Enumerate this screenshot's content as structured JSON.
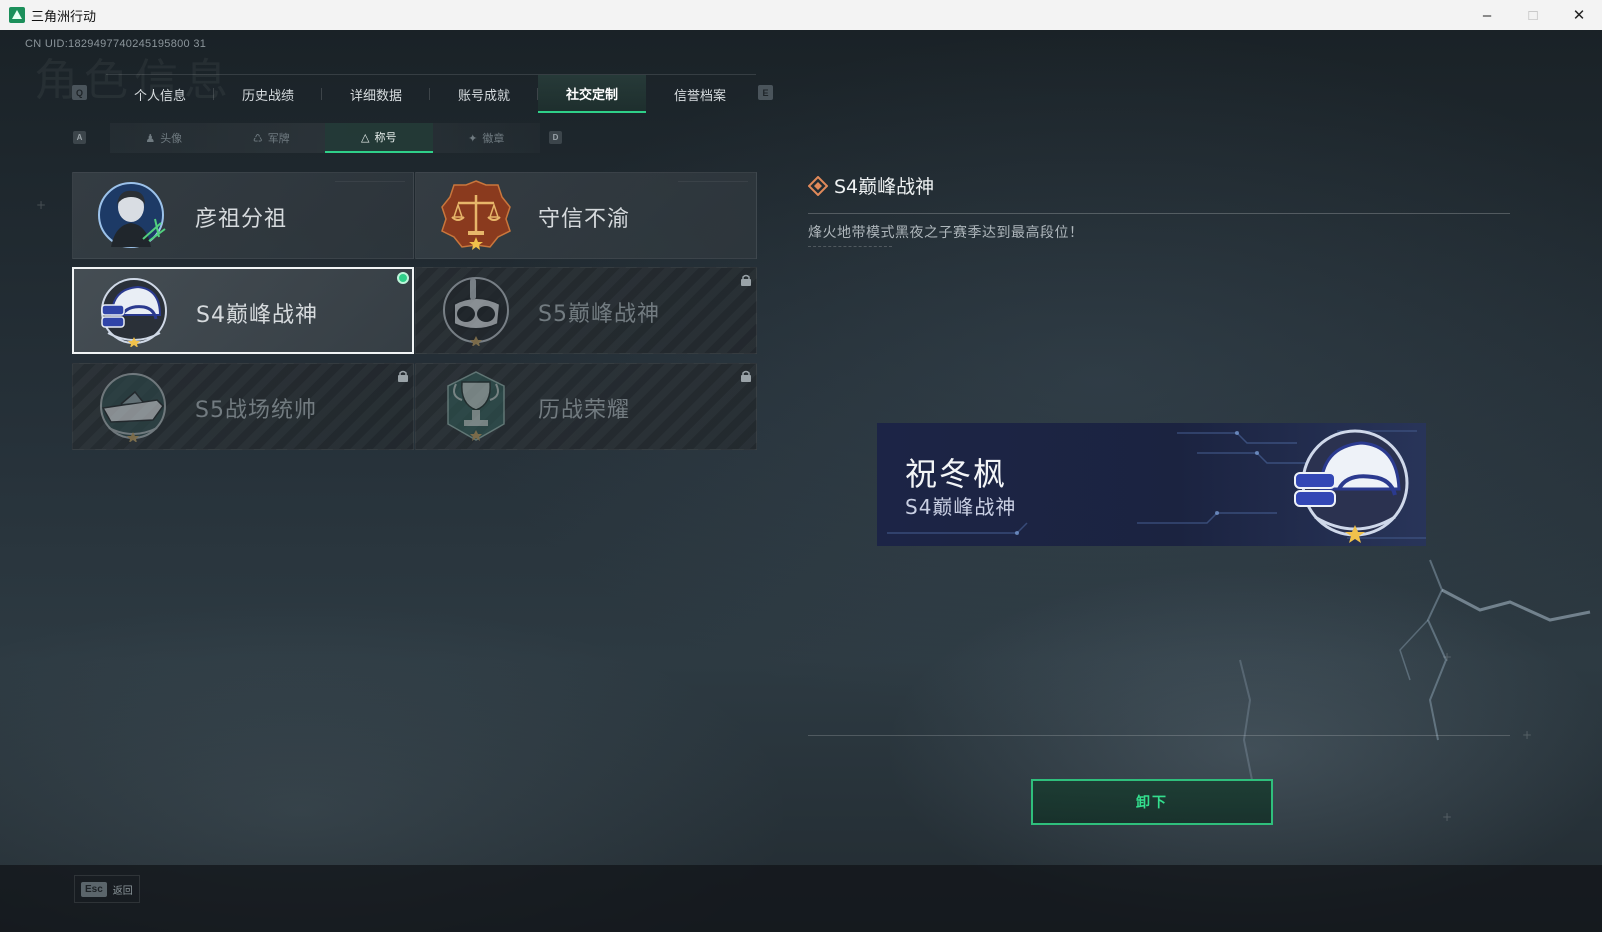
{
  "window": {
    "title": "三角洲行动",
    "minimize": "–",
    "maximize": "□",
    "close": "✕"
  },
  "uid": "CN UID:1829497740245195800 31",
  "background_title": "角色信息",
  "main_tabs": {
    "prev_key": "Q",
    "next_key": "E",
    "items": [
      {
        "label": "个人信息"
      },
      {
        "label": "历史战绩"
      },
      {
        "label": "详细数据"
      },
      {
        "label": "账号成就"
      },
      {
        "label": "社交定制",
        "active": true
      },
      {
        "label": "信誉档案"
      }
    ]
  },
  "sub_tabs": {
    "prev_key": "A",
    "next_key": "D",
    "items": [
      {
        "label": "头像",
        "icon": "person-icon"
      },
      {
        "label": "军牌",
        "icon": "dogtag-icon"
      },
      {
        "label": "称号",
        "icon": "triangle-icon",
        "active": true
      },
      {
        "label": "徽章",
        "icon": "emblem-icon"
      }
    ]
  },
  "titles": [
    {
      "name": "彦祖分祖",
      "badge": "portrait-badge-icon",
      "locked": false,
      "selected": false
    },
    {
      "name": "守信不渝",
      "badge": "scales-badge-icon",
      "locked": false,
      "selected": false
    },
    {
      "name": "S4巅峰战神",
      "badge": "night-vision-helmet-badge-icon",
      "locked": false,
      "selected": true,
      "equipped": true
    },
    {
      "name": "S5巅峰战神",
      "badge": "diving-mask-badge-icon",
      "locked": true,
      "selected": false
    },
    {
      "name": "S5战场统帅",
      "badge": "speedboat-badge-icon",
      "locked": true,
      "selected": false
    },
    {
      "name": "历战荣耀",
      "badge": "trophy-badge-icon",
      "locked": true,
      "selected": false
    }
  ],
  "detail": {
    "title": "S4巅峰战神",
    "description": "烽火地带模式黑夜之子赛季达到最高段位！",
    "nameplate": {
      "player_name": "祝冬枫",
      "title": "S4巅峰战神"
    },
    "unequip_button": "卸下"
  },
  "footer": {
    "esc_key": "Esc",
    "back_label": "返回"
  },
  "colors": {
    "accent_green": "#2fd089",
    "nameplate_bg": "#1c2446"
  }
}
